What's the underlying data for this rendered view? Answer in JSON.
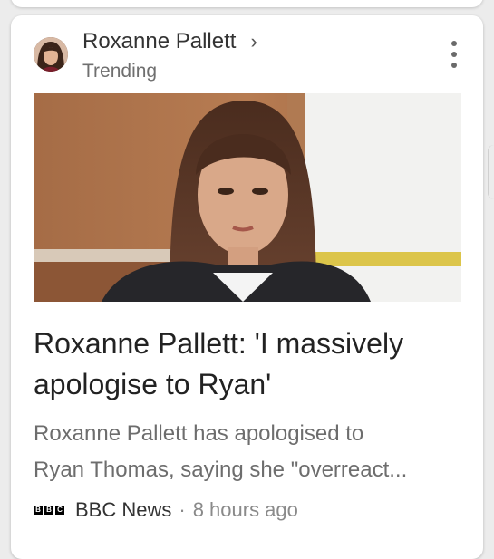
{
  "topic": {
    "title": "Roxanne Pallett",
    "subtitle": "Trending",
    "chevron_icon": "chevron-right-icon",
    "menu_icon": "more-vert-icon"
  },
  "article": {
    "headline": "Roxanne Pallett: 'I massively apologise to Ryan'",
    "snippet_line1": "Roxanne Pallett has apologised to",
    "snippet_line2": "Ryan Thomas, saying she \"overreact...",
    "image": "woman-with-bangs-tv-studio-photo"
  },
  "source": {
    "logo_letters": [
      "B",
      "B",
      "C"
    ],
    "name": "BBC News",
    "separator": "·",
    "time": "8 hours ago"
  },
  "colors": {
    "card": "#ffffff",
    "background": "#ececec",
    "headline": "#222222",
    "secondary": "#6d6d6d"
  }
}
